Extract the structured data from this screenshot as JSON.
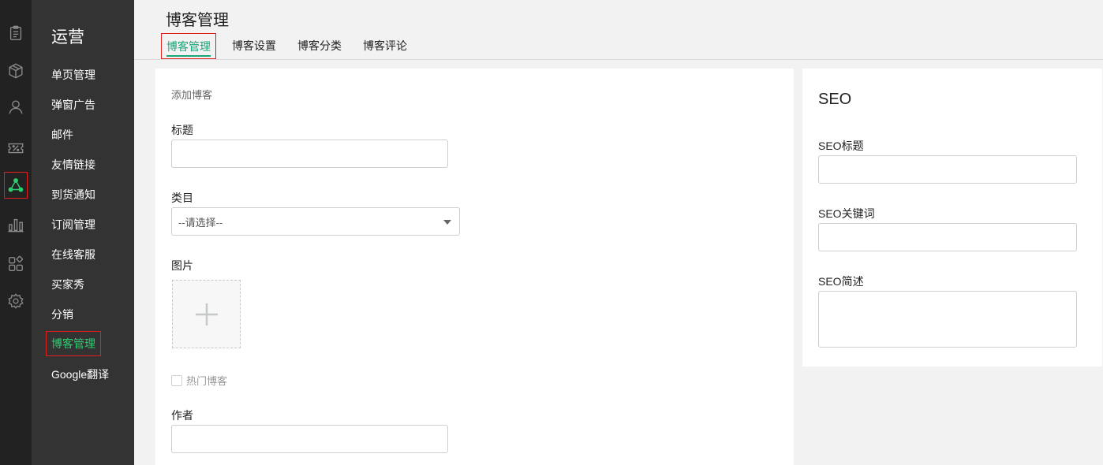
{
  "rail": {
    "icons": [
      "clipboard-icon",
      "box-icon",
      "user-icon",
      "coupon-icon",
      "share-icon",
      "chart-icon",
      "apps-icon",
      "gear-icon"
    ],
    "active_color": "#2ecc71"
  },
  "subnav": {
    "title": "运营",
    "items": [
      {
        "label": "单页管理"
      },
      {
        "label": "弹窗广告"
      },
      {
        "label": "邮件"
      },
      {
        "label": "友情链接"
      },
      {
        "label": "到货通知"
      },
      {
        "label": "订阅管理"
      },
      {
        "label": "在线客服"
      },
      {
        "label": "买家秀"
      },
      {
        "label": "分销"
      },
      {
        "label": "博客管理"
      },
      {
        "label": "Google翻译"
      }
    ],
    "active_index": 9
  },
  "header": {
    "title": "博客管理",
    "tabs": [
      {
        "label": "博客管理"
      },
      {
        "label": "博客设置"
      },
      {
        "label": "博客分类"
      },
      {
        "label": "博客评论"
      }
    ],
    "accent": "#1aa57a"
  },
  "form": {
    "section_title": "添加博客",
    "title_label": "标题",
    "title_value": "",
    "category_label": "类目",
    "category_selected": "--请选择--",
    "image_label": "图片",
    "hot_label": "热门博客",
    "author_label": "作者",
    "author_value": ""
  },
  "seo": {
    "title": "SEO",
    "seo_title_label": "SEO标题",
    "seo_keywords_label": "SEO关键词",
    "seo_desc_label": "SEO简述"
  }
}
